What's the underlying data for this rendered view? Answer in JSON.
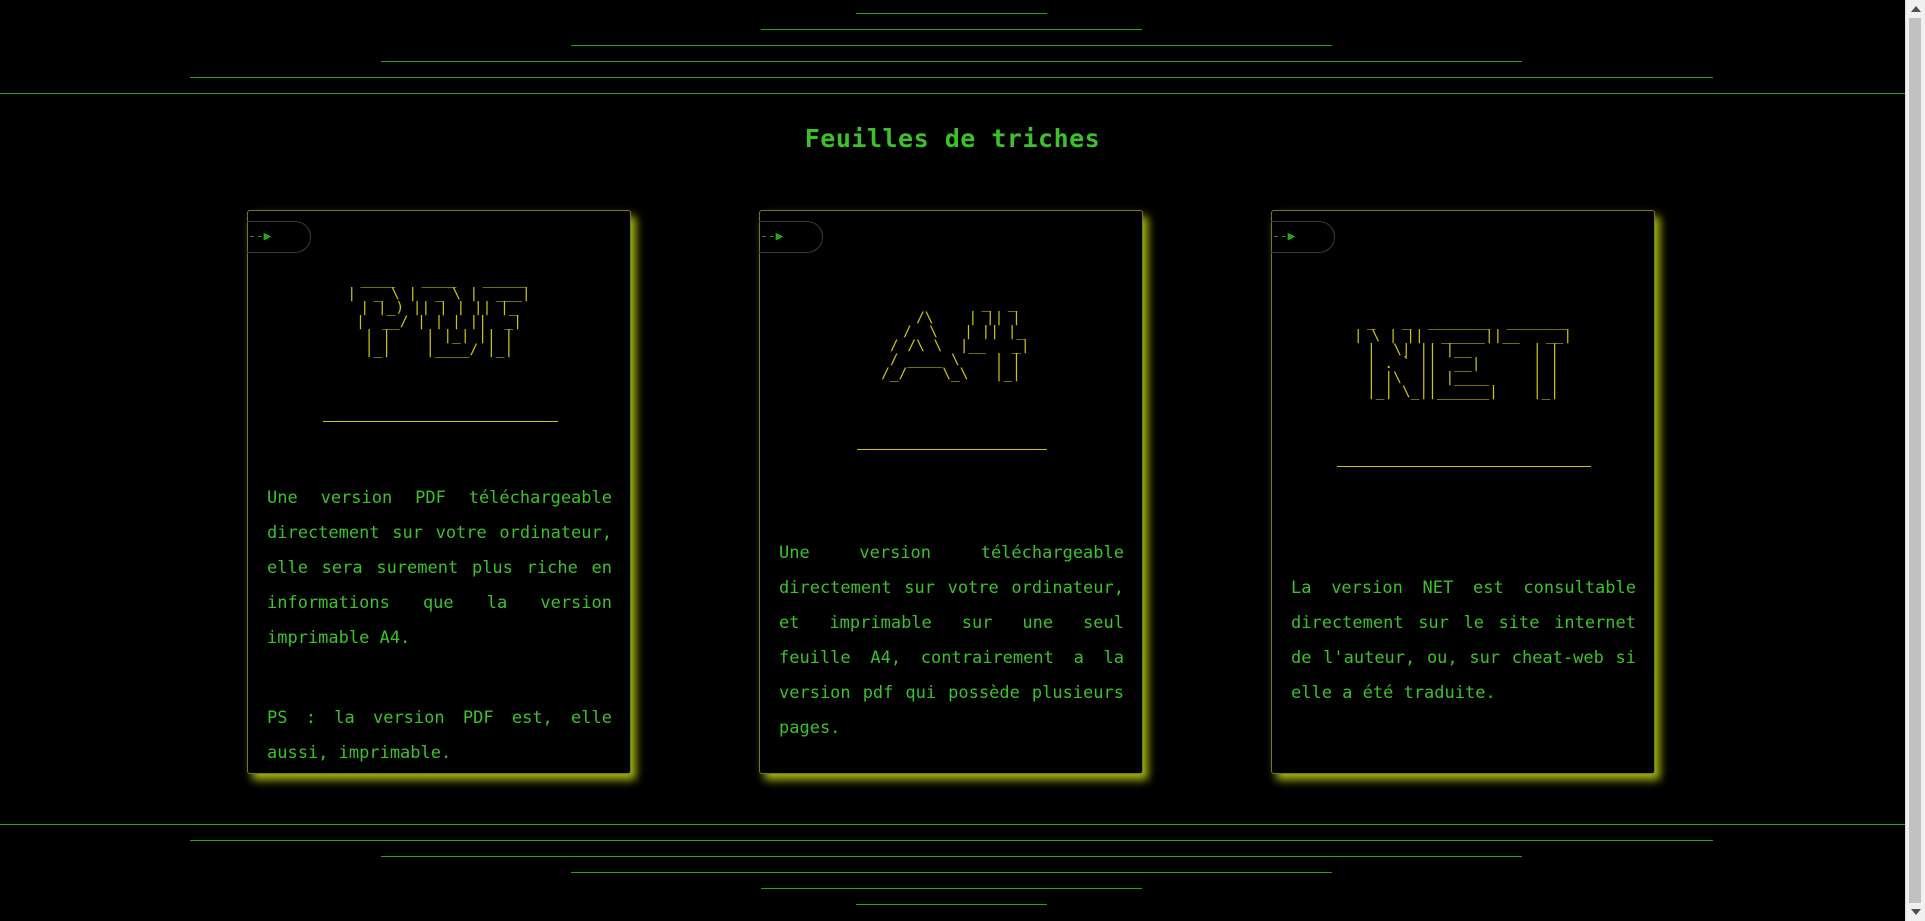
{
  "title": "Feuilles de triches",
  "cards": [
    {
      "tag": "--▶",
      "ascii_art": " ____   ____   _____\n|  _ \\ |  _ \\ |  ___|\n| |_) || | | || |_\n|  __/ | | | ||  _|\n| |    | |_| || |\n|_|    |____/ |_|",
      "paragraphs": [
        "Une version PDF téléchargeable directement sur votre ordinateur, elle sera surement plus riche en informations que la version imprimable A4.",
        "PS : la version PDF est, elle aussi, imprimable."
      ]
    },
    {
      "tag": "--▶",
      "ascii_art": "           _  _\n    /\\    | || |\n   /  \\   | || |_\n  / /\\ \\  |__   _|\n / ____ \\    | |\n/_/    \\_\\   |_|",
      "paragraphs": [
        "Une version téléchargeable directement sur votre ordinateur, et imprimable sur une seul feuille A4, contrairement a la version pdf qui possède plusieurs pages."
      ]
    },
    {
      "tag": "--▶",
      "ascii_art": " _   _  _______  _______\n| \\ | ||  _____||__   __|\n|  \\| || |__       | |\n| . ` ||  __|      | |\n| |\\  || |____     | |\n|_| \\_||______|    |_|",
      "paragraphs": [
        "La version NET est consultable directement sur le site internet de l'auteur, ou, sur cheat-web si elle a été traduite."
      ]
    }
  ],
  "colors": {
    "background": "#000000",
    "text_green": "#3cc12b",
    "line_green": "#2e9c1f",
    "ascii_yellow": "#c9c217",
    "card_glow": "#c8d714"
  }
}
